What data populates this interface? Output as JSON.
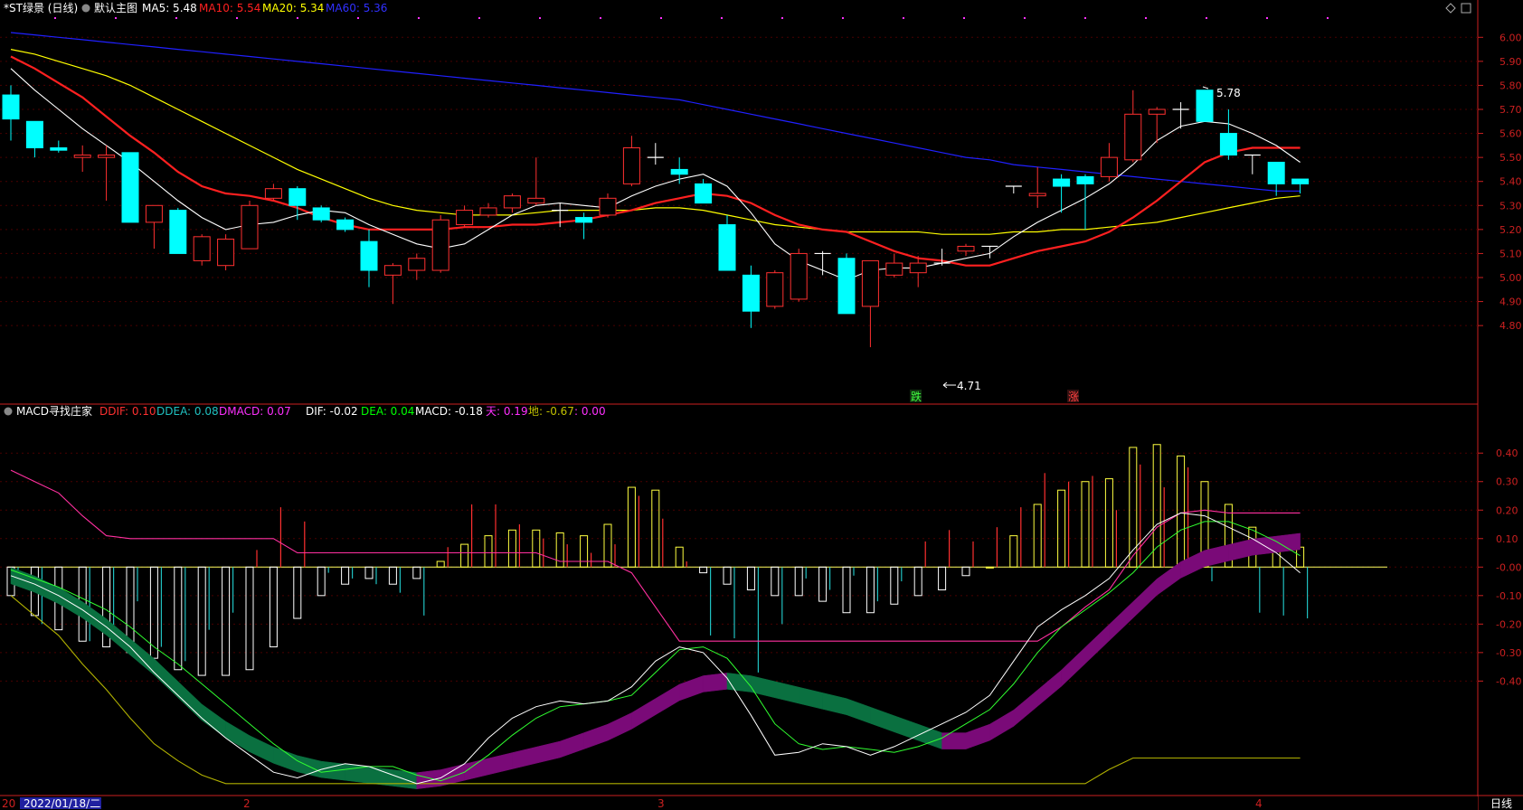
{
  "header": {
    "title": "*ST绿景 (日线)",
    "template": "默认主图",
    "ma5": {
      "label": "MA5: 5.48",
      "color": "#ffffff"
    },
    "ma10": {
      "label": "MA10: 5.54",
      "color": "#ff2020"
    },
    "ma20": {
      "label": "MA20: 5.34",
      "color": "#ffff00"
    },
    "ma60": {
      "label": "MA60: 5.36",
      "color": "#2020ff"
    }
  },
  "sub_header": {
    "name": "MACD寻找庄家",
    "ddif": {
      "label": "DDIF: 0.10",
      "color": "#ff3030"
    },
    "ddea": {
      "label": "DDEA: 0.08",
      "color": "#20c0c0"
    },
    "dmacd": {
      "label": "DMACD: 0.07",
      "color": "#ff30ff"
    },
    "dif": {
      "label": "DIF: -0.02",
      "color": "#ffffff"
    },
    "dea": {
      "label": "DEA: 0.04",
      "color": "#00ff00"
    },
    "macd": {
      "label": "MACD: -0.18",
      "color": "#ffffff"
    },
    "tian": {
      "label": "天: 0.19",
      "color": "#ff30ff"
    },
    "di": {
      "label": "地: -0.67",
      "color": "#c0c000"
    },
    "extra": {
      "label": ": 0.00",
      "color": "#ff30ff"
    }
  },
  "footer": {
    "date_label": "2022/01/18/二",
    "month_marks": [
      "20",
      "2",
      "3",
      "4"
    ],
    "period": "日线"
  },
  "markers": {
    "die": "跌",
    "zhang": "涨",
    "high": "5.78",
    "low": "4.71"
  },
  "colors": {
    "up": "#ff3030",
    "down": "#00ffff",
    "axis": "#cc2020",
    "grid": "#4a0000",
    "band_green": "#0a7040",
    "band_purple": "#7a0a78"
  },
  "chart_data": [
    {
      "type": "candlestick",
      "title": "*ST绿景 (日线)",
      "y_ticks": [
        "6.00",
        "5.90",
        "5.80",
        "5.70",
        "5.60",
        "5.50",
        "5.40",
        "5.30",
        "5.20",
        "5.10",
        "5.00",
        "4.90",
        "4.80"
      ],
      "ylim": [
        4.65,
        6.05
      ],
      "candles": [
        {
          "o": 5.76,
          "h": 5.8,
          "l": 5.57,
          "c": 5.66
        },
        {
          "o": 5.65,
          "h": 5.65,
          "l": 5.5,
          "c": 5.54
        },
        {
          "o": 5.54,
          "h": 5.57,
          "l": 5.52,
          "c": 5.53
        },
        {
          "o": 5.5,
          "h": 5.55,
          "l": 5.44,
          "c": 5.51
        },
        {
          "o": 5.5,
          "h": 5.55,
          "l": 5.32,
          "c": 5.51
        },
        {
          "o": 5.52,
          "h": 5.52,
          "l": 5.23,
          "c": 5.23
        },
        {
          "o": 5.23,
          "h": 5.3,
          "l": 5.12,
          "c": 5.3
        },
        {
          "o": 5.28,
          "h": 5.29,
          "l": 5.1,
          "c": 5.1
        },
        {
          "o": 5.07,
          "h": 5.18,
          "l": 5.05,
          "c": 5.17
        },
        {
          "o": 5.05,
          "h": 5.18,
          "l": 5.03,
          "c": 5.16
        },
        {
          "o": 5.12,
          "h": 5.32,
          "l": 5.12,
          "c": 5.3
        },
        {
          "o": 5.33,
          "h": 5.39,
          "l": 5.32,
          "c": 5.37
        },
        {
          "o": 5.37,
          "h": 5.38,
          "l": 5.24,
          "c": 5.3
        },
        {
          "o": 5.29,
          "h": 5.3,
          "l": 5.23,
          "c": 5.24
        },
        {
          "o": 5.24,
          "h": 5.25,
          "l": 5.19,
          "c": 5.2
        },
        {
          "o": 5.15,
          "h": 5.2,
          "l": 4.96,
          "c": 5.03
        },
        {
          "o": 5.01,
          "h": 5.06,
          "l": 4.89,
          "c": 5.05
        },
        {
          "o": 5.03,
          "h": 5.1,
          "l": 4.99,
          "c": 5.08
        },
        {
          "o": 5.03,
          "h": 5.26,
          "l": 5.02,
          "c": 5.24
        },
        {
          "o": 5.22,
          "h": 5.3,
          "l": 5.21,
          "c": 5.28
        },
        {
          "o": 5.26,
          "h": 5.31,
          "l": 5.25,
          "c": 5.29
        },
        {
          "o": 5.29,
          "h": 5.35,
          "l": 5.27,
          "c": 5.34
        },
        {
          "o": 5.31,
          "h": 5.5,
          "l": 5.3,
          "c": 5.33
        },
        {
          "o": 5.28,
          "h": 5.31,
          "l": 5.21,
          "c": 5.28
        },
        {
          "o": 5.25,
          "h": 5.27,
          "l": 5.16,
          "c": 5.23
        },
        {
          "o": 5.26,
          "h": 5.35,
          "l": 5.25,
          "c": 5.33
        },
        {
          "o": 5.39,
          "h": 5.59,
          "l": 5.38,
          "c": 5.54
        },
        {
          "o": 5.5,
          "h": 5.56,
          "l": 5.47,
          "c": 5.5
        },
        {
          "o": 5.45,
          "h": 5.5,
          "l": 5.39,
          "c": 5.43
        },
        {
          "o": 5.39,
          "h": 5.41,
          "l": 5.31,
          "c": 5.31
        },
        {
          "o": 5.22,
          "h": 5.26,
          "l": 5.03,
          "c": 5.03
        },
        {
          "o": 5.01,
          "h": 5.05,
          "l": 4.79,
          "c": 4.86
        },
        {
          "o": 4.88,
          "h": 5.03,
          "l": 4.87,
          "c": 5.02
        },
        {
          "o": 4.91,
          "h": 5.12,
          "l": 4.9,
          "c": 5.1
        },
        {
          "o": 5.1,
          "h": 5.11,
          "l": 5.01,
          "c": 5.1
        },
        {
          "o": 5.08,
          "h": 5.1,
          "l": 4.85,
          "c": 4.85
        },
        {
          "o": 4.88,
          "h": 5.07,
          "l": 4.71,
          "c": 5.07
        },
        {
          "o": 5.01,
          "h": 5.1,
          "l": 5.0,
          "c": 5.06
        },
        {
          "o": 5.02,
          "h": 5.09,
          "l": 4.96,
          "c": 5.06
        },
        {
          "o": 5.06,
          "h": 5.12,
          "l": 5.05,
          "c": 5.06
        },
        {
          "o": 5.11,
          "h": 5.14,
          "l": 5.09,
          "c": 5.13
        },
        {
          "o": 5.13,
          "h": 5.13,
          "l": 5.08,
          "c": 5.13
        },
        {
          "o": 5.38,
          "h": 5.38,
          "l": 5.35,
          "c": 5.38
        },
        {
          "o": 5.34,
          "h": 5.46,
          "l": 5.29,
          "c": 5.35
        },
        {
          "o": 5.41,
          "h": 5.43,
          "l": 5.27,
          "c": 5.38
        },
        {
          "o": 5.42,
          "h": 5.43,
          "l": 5.2,
          "c": 5.39
        },
        {
          "o": 5.42,
          "h": 5.56,
          "l": 5.4,
          "c": 5.5
        },
        {
          "o": 5.49,
          "h": 5.78,
          "l": 5.48,
          "c": 5.68
        },
        {
          "o": 5.68,
          "h": 5.71,
          "l": 5.56,
          "c": 5.7
        },
        {
          "o": 5.7,
          "h": 5.73,
          "l": 5.62,
          "c": 5.7
        },
        {
          "o": 5.78,
          "h": 5.78,
          "l": 5.65,
          "c": 5.65
        },
        {
          "o": 5.6,
          "h": 5.7,
          "l": 5.49,
          "c": 5.51
        },
        {
          "o": 5.51,
          "h": 5.51,
          "l": 5.43,
          "c": 5.51
        },
        {
          "o": 5.48,
          "h": 5.48,
          "l": 5.34,
          "c": 5.39
        },
        {
          "o": 5.41,
          "h": 5.41,
          "l": 5.35,
          "c": 5.39
        }
      ],
      "ma5": [
        5.87,
        5.78,
        5.7,
        5.62,
        5.55,
        5.48,
        5.4,
        5.32,
        5.25,
        5.2,
        5.22,
        5.23,
        5.26,
        5.28,
        5.27,
        5.22,
        5.18,
        5.14,
        5.12,
        5.14,
        5.2,
        5.26,
        5.3,
        5.31,
        5.3,
        5.29,
        5.34,
        5.38,
        5.41,
        5.43,
        5.38,
        5.27,
        5.14,
        5.07,
        5.03,
        4.99,
        5.03,
        5.04,
        5.04,
        5.06,
        5.08,
        5.1,
        5.17,
        5.23,
        5.28,
        5.33,
        5.39,
        5.47,
        5.57,
        5.63,
        5.65,
        5.64,
        5.6,
        5.55,
        5.48
      ],
      "ma10": [
        5.92,
        5.87,
        5.81,
        5.75,
        5.67,
        5.59,
        5.52,
        5.44,
        5.38,
        5.35,
        5.34,
        5.32,
        5.29,
        5.25,
        5.22,
        5.2,
        5.2,
        5.2,
        5.2,
        5.21,
        5.21,
        5.22,
        5.22,
        5.23,
        5.24,
        5.26,
        5.28,
        5.31,
        5.33,
        5.35,
        5.34,
        5.31,
        5.26,
        5.22,
        5.2,
        5.19,
        5.15,
        5.11,
        5.08,
        5.07,
        5.05,
        5.05,
        5.08,
        5.11,
        5.13,
        5.15,
        5.19,
        5.25,
        5.32,
        5.4,
        5.48,
        5.52,
        5.54,
        5.54,
        5.54
      ],
      "ma20": [
        5.95,
        5.93,
        5.9,
        5.87,
        5.84,
        5.8,
        5.75,
        5.7,
        5.65,
        5.6,
        5.55,
        5.5,
        5.45,
        5.41,
        5.37,
        5.33,
        5.3,
        5.28,
        5.27,
        5.26,
        5.26,
        5.26,
        5.27,
        5.28,
        5.28,
        5.28,
        5.28,
        5.29,
        5.29,
        5.28,
        5.26,
        5.24,
        5.22,
        5.21,
        5.2,
        5.19,
        5.19,
        5.19,
        5.19,
        5.18,
        5.18,
        5.18,
        5.19,
        5.19,
        5.2,
        5.2,
        5.21,
        5.22,
        5.23,
        5.25,
        5.27,
        5.29,
        5.31,
        5.33,
        5.34
      ],
      "ma60": [
        6.02,
        6.01,
        6.0,
        5.99,
        5.98,
        5.97,
        5.96,
        5.95,
        5.94,
        5.93,
        5.92,
        5.91,
        5.9,
        5.89,
        5.88,
        5.87,
        5.86,
        5.85,
        5.84,
        5.83,
        5.82,
        5.81,
        5.8,
        5.79,
        5.78,
        5.77,
        5.76,
        5.75,
        5.74,
        5.72,
        5.7,
        5.68,
        5.66,
        5.64,
        5.62,
        5.6,
        5.58,
        5.56,
        5.54,
        5.52,
        5.5,
        5.49,
        5.47,
        5.46,
        5.45,
        5.44,
        5.43,
        5.42,
        5.41,
        5.4,
        5.39,
        5.38,
        5.37,
        5.36,
        5.36
      ]
    },
    {
      "type": "bar",
      "title": "MACD寻找庄家",
      "y_ticks": [
        "0.40",
        "0.30",
        "0.20",
        "0.10",
        "-0.00",
        "-0.10",
        "-0.20",
        "-0.30",
        "-0.40"
      ],
      "ylim": [
        -0.77,
        0.48
      ],
      "macd_hist": [
        -0.1,
        -0.17,
        -0.22,
        -0.26,
        -0.28,
        -0.3,
        -0.32,
        -0.36,
        -0.38,
        -0.38,
        -0.36,
        -0.28,
        -0.18,
        -0.1,
        -0.06,
        -0.04,
        -0.06,
        -0.04,
        0.02,
        0.08,
        0.11,
        0.13,
        0.13,
        0.12,
        0.11,
        0.15,
        0.28,
        0.27,
        0.07,
        -0.02,
        -0.06,
        -0.08,
        -0.1,
        -0.1,
        -0.12,
        -0.16,
        -0.16,
        -0.13,
        -0.1,
        -0.08,
        -0.03,
        0.0,
        0.11,
        0.22,
        0.27,
        0.3,
        0.31,
        0.42,
        0.43,
        0.39,
        0.3,
        0.22,
        0.14,
        0.06,
        0.07
      ],
      "spike_lines": [
        -0.01,
        -0.2,
        0.0,
        -0.26,
        -0.24,
        -0.12,
        -0.28,
        -0.33,
        -0.22,
        -0.16,
        0.06,
        0.21,
        0.16,
        -0.02,
        -0.04,
        -0.06,
        -0.09,
        -0.17,
        0.07,
        0.22,
        0.22,
        0.15,
        0.1,
        0.08,
        0.05,
        0.08,
        0.25,
        0.17,
        0.02,
        -0.24,
        -0.25,
        -0.37,
        -0.2,
        -0.04,
        -0.08,
        -0.03,
        -0.12,
        -0.05,
        0.09,
        0.13,
        0.09,
        0.14,
        0.21,
        0.33,
        0.3,
        0.32,
        0.2,
        0.36,
        0.28,
        0.35,
        -0.05,
        0.0,
        -0.16,
        -0.17,
        -0.18
      ],
      "dif": [
        -0.03,
        -0.06,
        -0.1,
        -0.15,
        -0.21,
        -0.28,
        -0.37,
        -0.45,
        -0.53,
        -0.6,
        -0.66,
        -0.72,
        -0.74,
        -0.71,
        -0.69,
        -0.7,
        -0.73,
        -0.76,
        -0.74,
        -0.69,
        -0.6,
        -0.53,
        -0.49,
        -0.47,
        -0.48,
        -0.47,
        -0.42,
        -0.33,
        -0.28,
        -0.3,
        -0.39,
        -0.52,
        -0.66,
        -0.65,
        -0.62,
        -0.63,
        -0.66,
        -0.63,
        -0.59,
        -0.55,
        -0.51,
        -0.45,
        -0.33,
        -0.21,
        -0.15,
        -0.1,
        -0.04,
        0.06,
        0.15,
        0.19,
        0.18,
        0.14,
        0.1,
        0.05,
        -0.02
      ],
      "dea": [
        -0.01,
        -0.04,
        -0.07,
        -0.11,
        -0.15,
        -0.21,
        -0.28,
        -0.34,
        -0.41,
        -0.48,
        -0.55,
        -0.62,
        -0.68,
        -0.72,
        -0.71,
        -0.7,
        -0.7,
        -0.73,
        -0.75,
        -0.72,
        -0.66,
        -0.59,
        -0.53,
        -0.49,
        -0.48,
        -0.47,
        -0.45,
        -0.37,
        -0.29,
        -0.28,
        -0.32,
        -0.42,
        -0.55,
        -0.62,
        -0.64,
        -0.63,
        -0.64,
        -0.65,
        -0.63,
        -0.6,
        -0.55,
        -0.5,
        -0.41,
        -0.3,
        -0.21,
        -0.15,
        -0.09,
        -0.02,
        0.07,
        0.13,
        0.16,
        0.16,
        0.13,
        0.09,
        0.04
      ],
      "band_mid": [
        -0.03,
        -0.06,
        -0.1,
        -0.15,
        -0.21,
        -0.28,
        -0.35,
        -0.43,
        -0.51,
        -0.57,
        -0.62,
        -0.66,
        -0.69,
        -0.71,
        -0.72,
        -0.73,
        -0.74,
        -0.75,
        -0.74,
        -0.72,
        -0.7,
        -0.68,
        -0.66,
        -0.64,
        -0.61,
        -0.58,
        -0.54,
        -0.49,
        -0.44,
        -0.41,
        -0.4,
        -0.41,
        -0.43,
        -0.45,
        -0.47,
        -0.49,
        -0.52,
        -0.55,
        -0.58,
        -0.61,
        -0.61,
        -0.58,
        -0.53,
        -0.46,
        -0.39,
        -0.31,
        -0.23,
        -0.15,
        -0.07,
        -0.01,
        0.03,
        0.05,
        0.07,
        0.08,
        0.09
      ],
      "tian": [
        0.34,
        0.3,
        0.26,
        0.18,
        0.11,
        0.1,
        0.1,
        0.1,
        0.1,
        0.1,
        0.1,
        0.1,
        0.05,
        0.05,
        0.05,
        0.05,
        0.05,
        0.05,
        0.05,
        0.05,
        0.05,
        0.05,
        0.05,
        0.02,
        0.02,
        0.02,
        -0.02,
        -0.14,
        -0.26,
        -0.26,
        -0.26,
        -0.26,
        -0.26,
        -0.26,
        -0.26,
        -0.26,
        -0.26,
        -0.26,
        -0.26,
        -0.26,
        -0.26,
        -0.26,
        -0.26,
        -0.26,
        -0.21,
        -0.14,
        -0.08,
        0.04,
        0.14,
        0.19,
        0.2,
        0.19,
        0.19,
        0.19,
        0.19
      ],
      "di": [
        -0.1,
        -0.17,
        -0.24,
        -0.34,
        -0.43,
        -0.53,
        -0.62,
        -0.68,
        -0.73,
        -0.76,
        -0.76,
        -0.76,
        -0.76,
        -0.76,
        -0.76,
        -0.76,
        -0.76,
        -0.76,
        -0.76,
        -0.76,
        -0.76,
        -0.76,
        -0.76,
        -0.76,
        -0.76,
        -0.76,
        -0.76,
        -0.76,
        -0.76,
        -0.76,
        -0.76,
        -0.76,
        -0.76,
        -0.76,
        -0.76,
        -0.76,
        -0.76,
        -0.76,
        -0.76,
        -0.76,
        -0.76,
        -0.76,
        -0.76,
        -0.76,
        -0.76,
        -0.76,
        -0.71,
        -0.67,
        -0.67,
        -0.67,
        -0.67,
        -0.67,
        -0.67,
        -0.67,
        -0.67
      ]
    }
  ]
}
